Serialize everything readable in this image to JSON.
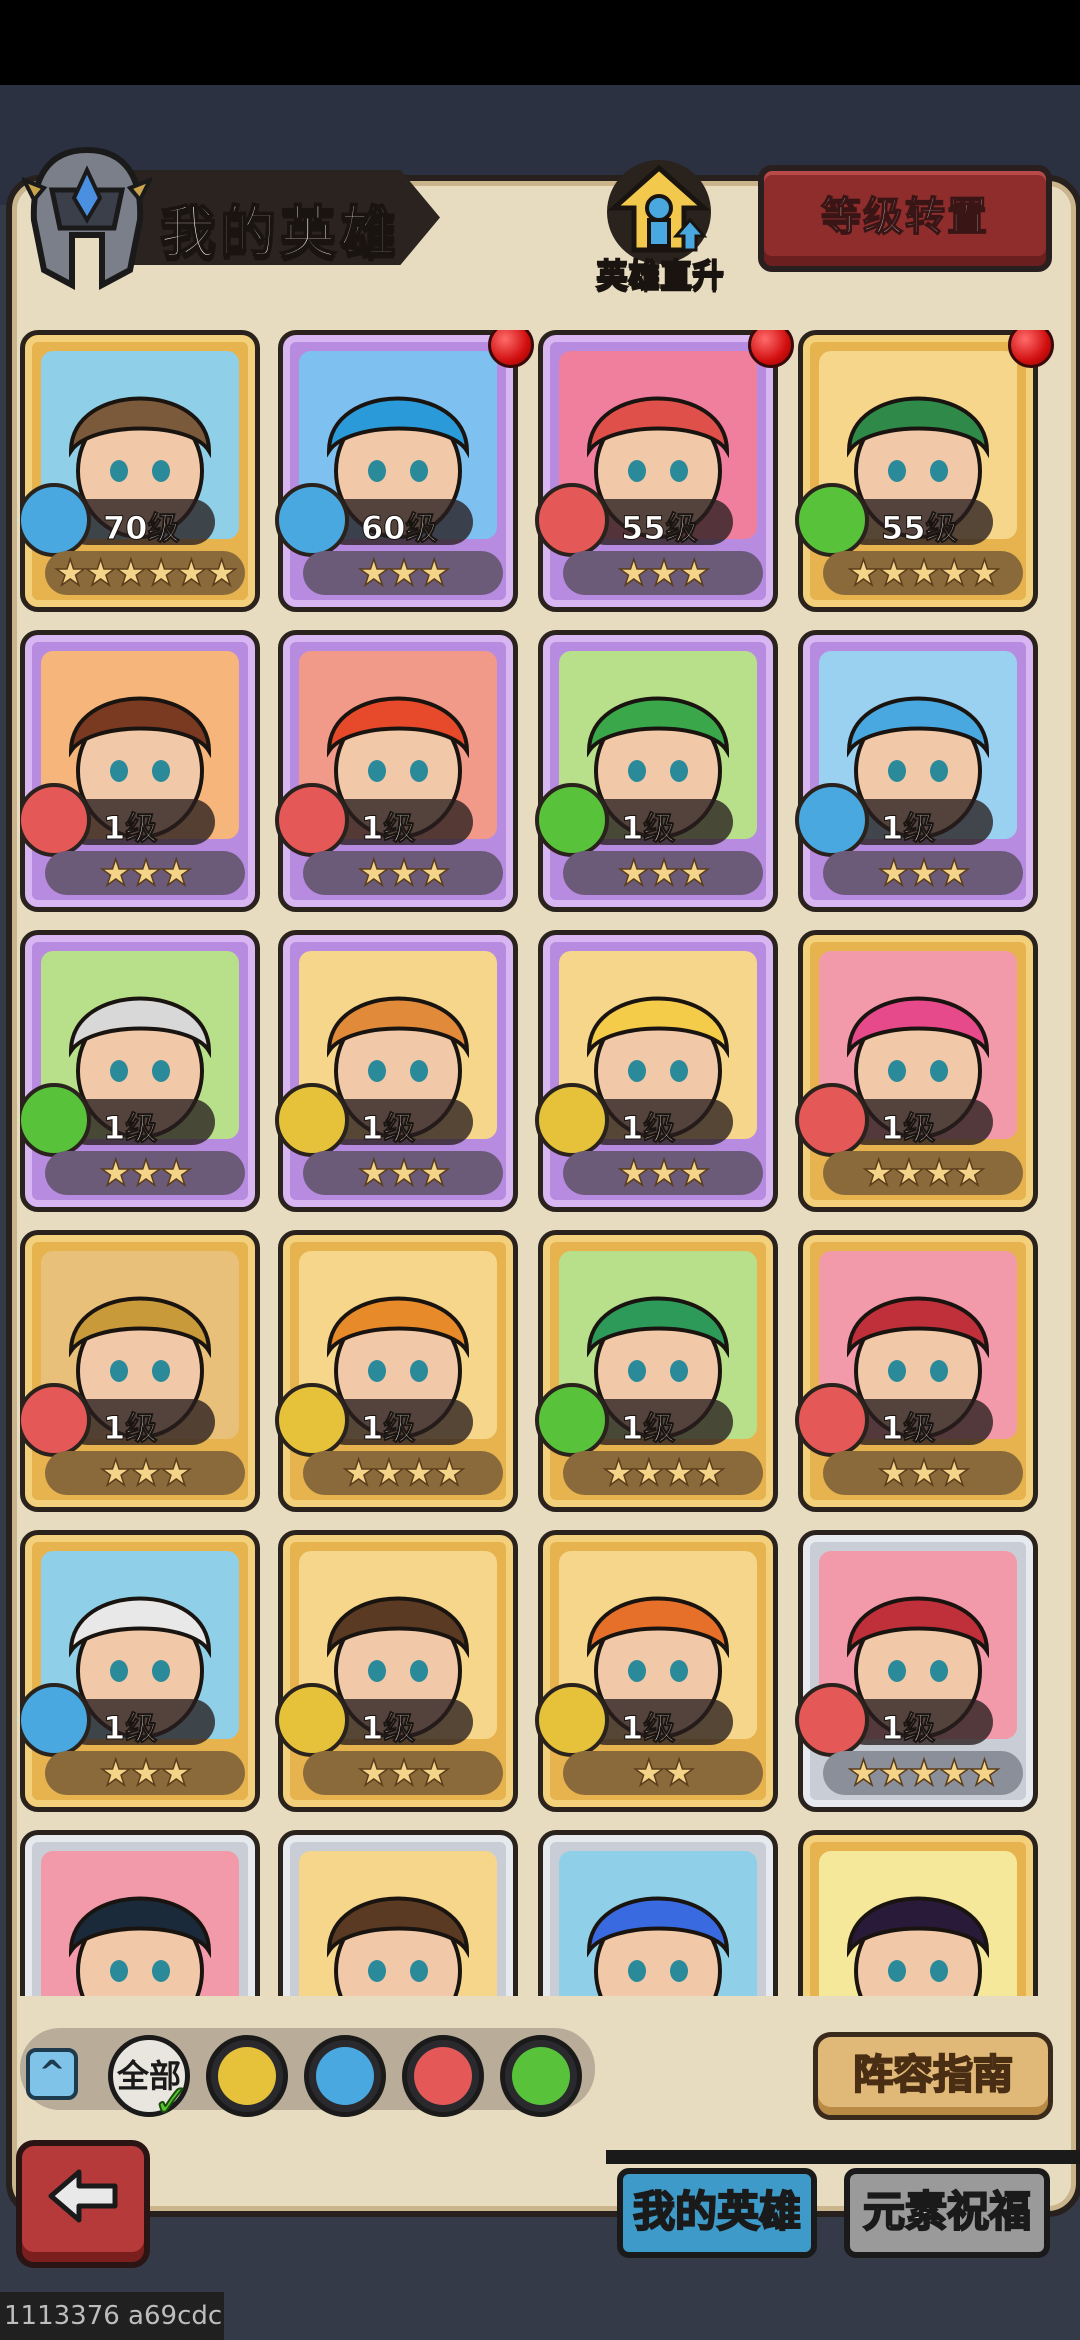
{
  "header": {
    "title": "我的英雄",
    "level_up_label": "英雄直升",
    "transfer_button": "等级转置"
  },
  "heroes": [
    {
      "level": "70级",
      "stars": "★★★★★★",
      "element": "water",
      "frame": "gold",
      "badge": false
    },
    {
      "level": "60级",
      "stars": "★★★",
      "element": "water",
      "frame": "purple",
      "badge": true
    },
    {
      "level": "55级",
      "stars": "★★★",
      "element": "fire",
      "frame": "purple",
      "badge": true
    },
    {
      "level": "55级",
      "stars": "★★★★★",
      "element": "wind",
      "frame": "gold",
      "badge": true
    },
    {
      "level": "1级",
      "stars": "★★★",
      "element": "fire",
      "frame": "purple",
      "badge": false
    },
    {
      "level": "1级",
      "stars": "★★★",
      "element": "fire",
      "frame": "purple",
      "badge": false
    },
    {
      "level": "1级",
      "stars": "★★★",
      "element": "wind",
      "frame": "purple",
      "badge": false
    },
    {
      "level": "1级",
      "stars": "★★★",
      "element": "water",
      "frame": "purple",
      "badge": false
    },
    {
      "level": "1级",
      "stars": "★★★",
      "element": "wind",
      "frame": "purple",
      "badge": false
    },
    {
      "level": "1级",
      "stars": "★★★",
      "element": "earth",
      "frame": "purple",
      "badge": false
    },
    {
      "level": "1级",
      "stars": "★★★",
      "element": "earth",
      "frame": "purple",
      "badge": false
    },
    {
      "level": "1级",
      "stars": "★★★★",
      "element": "fire",
      "frame": "gold",
      "badge": false
    },
    {
      "level": "1级",
      "stars": "★★★",
      "element": "fire",
      "frame": "gold",
      "badge": false
    },
    {
      "level": "1级",
      "stars": "★★★★",
      "element": "earth",
      "frame": "gold",
      "badge": false
    },
    {
      "level": "1级",
      "stars": "★★★★",
      "element": "wind",
      "frame": "gold",
      "badge": false
    },
    {
      "level": "1级",
      "stars": "★★★",
      "element": "fire",
      "frame": "gold",
      "badge": false
    },
    {
      "level": "1级",
      "stars": "★★★",
      "element": "water",
      "frame": "gold",
      "badge": false
    },
    {
      "level": "1级",
      "stars": "★★★",
      "element": "earth",
      "frame": "gold",
      "badge": false
    },
    {
      "level": "1级",
      "stars": "★★",
      "element": "earth",
      "frame": "gold",
      "badge": false
    },
    {
      "level": "1级",
      "stars": "★★★★★",
      "element": "fire",
      "frame": "silver",
      "badge": false
    },
    {
      "level": "",
      "stars": "",
      "element": "",
      "frame": "silver",
      "badge": false
    },
    {
      "level": "",
      "stars": "",
      "element": "",
      "frame": "silver",
      "badge": false
    },
    {
      "level": "",
      "stars": "",
      "element": "",
      "frame": "silver",
      "badge": false
    },
    {
      "level": "",
      "stars": "",
      "element": "",
      "frame": "gold",
      "badge": false
    }
  ],
  "filters": {
    "all_label": "全部",
    "elements": [
      "earth",
      "water",
      "fire",
      "wind"
    ],
    "selected": "all"
  },
  "footer": {
    "guide_button": "阵容指南",
    "tabs": [
      "我的英雄",
      "元素祝福"
    ],
    "active_tab": "我的英雄"
  },
  "watermark": "1113376 a69cdc",
  "colors": {
    "water": "#4aa8e0",
    "fire": "#e45858",
    "wind": "#58c23a",
    "earth": "#e6c23a"
  }
}
